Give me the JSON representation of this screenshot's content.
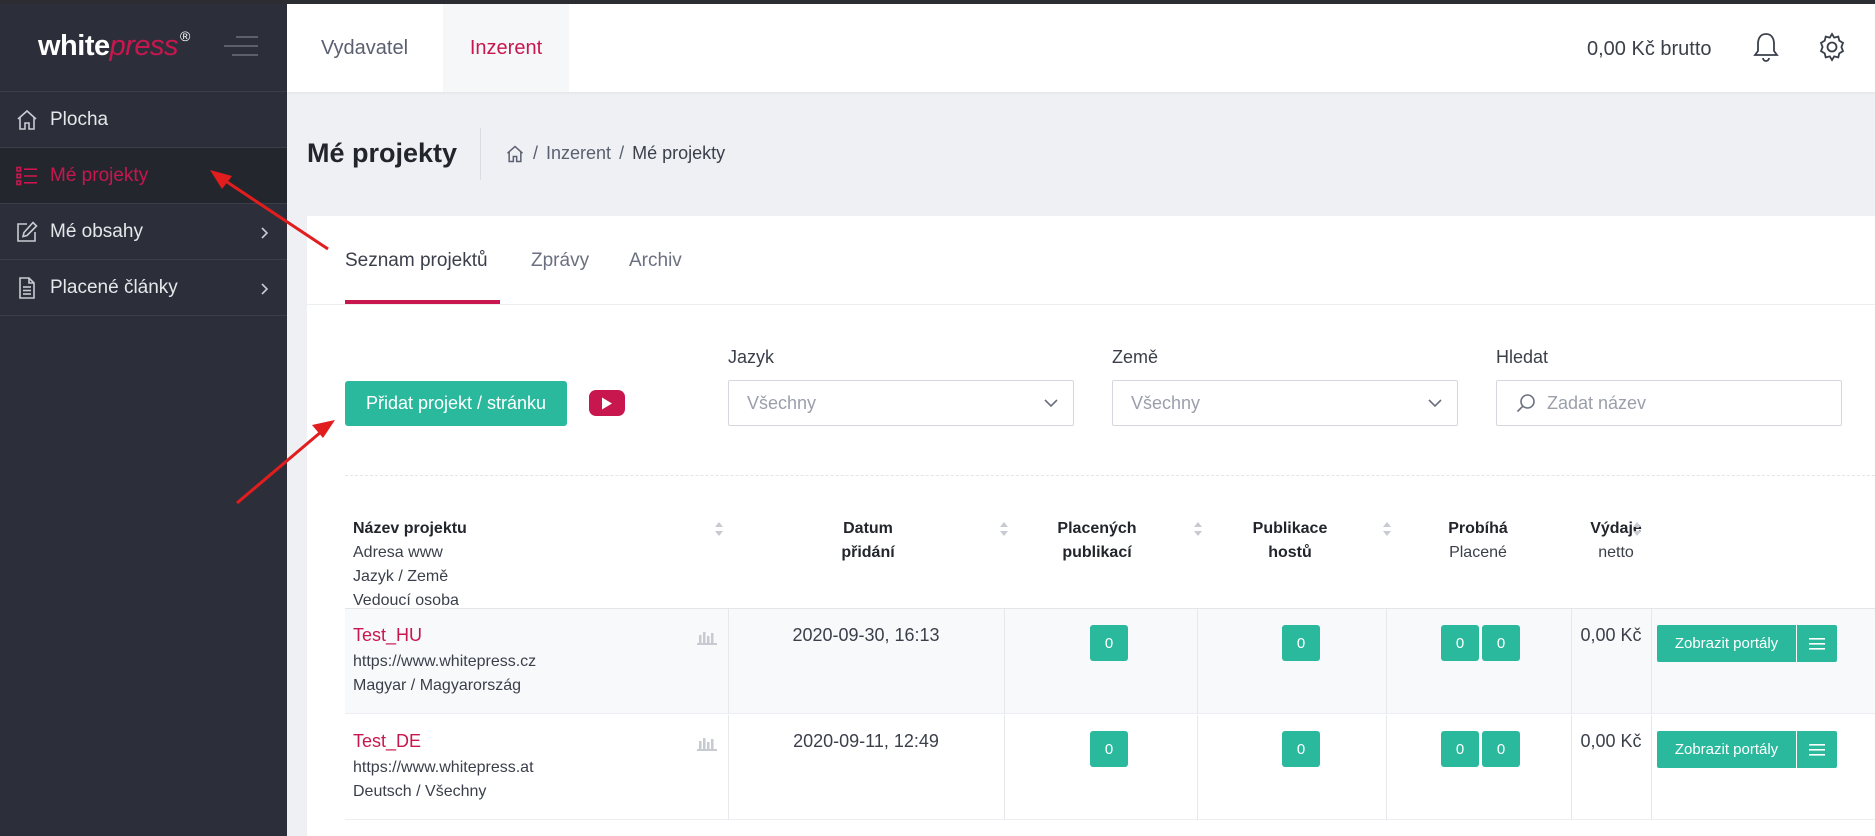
{
  "brand": {
    "logo_main": "white",
    "logo_accent": "press",
    "logo_mark": "®"
  },
  "sidebar": {
    "items": [
      {
        "label": "Plocha",
        "icon": "home-icon"
      },
      {
        "label": "Mé projekty",
        "icon": "list-icon"
      },
      {
        "label": "Mé obsahy",
        "icon": "edit-icon"
      },
      {
        "label": "Placené články",
        "icon": "document-icon"
      }
    ]
  },
  "header": {
    "publisher_tab": "Vydavatel",
    "advertiser_tab": "Inzerent",
    "balance": "0,00 Kč brutto"
  },
  "page": {
    "title": "Mé projekty",
    "breadcrumb": [
      "Inzerent",
      "Mé projekty"
    ]
  },
  "tabs": [
    "Seznam projektů",
    "Zprávy",
    "Archiv"
  ],
  "toolbar": {
    "add_label": "Přidat projekt / stránku"
  },
  "filters": {
    "language": {
      "label": "Jazyk",
      "value": "Všechny"
    },
    "country": {
      "label": "Země",
      "value": "Všechny"
    },
    "search": {
      "label": "Hledat",
      "placeholder": "Zadat název"
    }
  },
  "table": {
    "headers": {
      "name": [
        "Název projektu",
        "Adresa www",
        "Jazyk / Země",
        "Vedoucí osoba"
      ],
      "date": [
        "Datum",
        "přidání"
      ],
      "paid": [
        "Placených",
        "publikací"
      ],
      "guest": [
        "Publikace",
        "hostů"
      ],
      "running": [
        "Probíhá",
        "Placené"
      ],
      "spend": [
        "Výdaje",
        "netto"
      ]
    },
    "rows": [
      {
        "name": "Test_HU",
        "url": "https://www.whitepress.cz",
        "lang_country": "Magyar / Magyarország",
        "date": "2020-09-30, 16:13",
        "paid": "0",
        "guest": "0",
        "running_a": "0",
        "running_b": "0",
        "spend": "0,00 Kč",
        "action": "Zobrazit portály"
      },
      {
        "name": "Test_DE",
        "url": "https://www.whitepress.at",
        "lang_country": "Deutsch / Všechny",
        "date": "2020-09-11, 12:49",
        "paid": "0",
        "guest": "0",
        "running_a": "0",
        "running_b": "0",
        "spend": "0,00 Kč",
        "action": "Zobrazit portály"
      }
    ]
  },
  "colors": {
    "accent": "#c8174e",
    "primary_button": "#2bb99e",
    "sidebar_bg": "#2c2f3a",
    "annotation_arrow": "#e11d1d"
  }
}
